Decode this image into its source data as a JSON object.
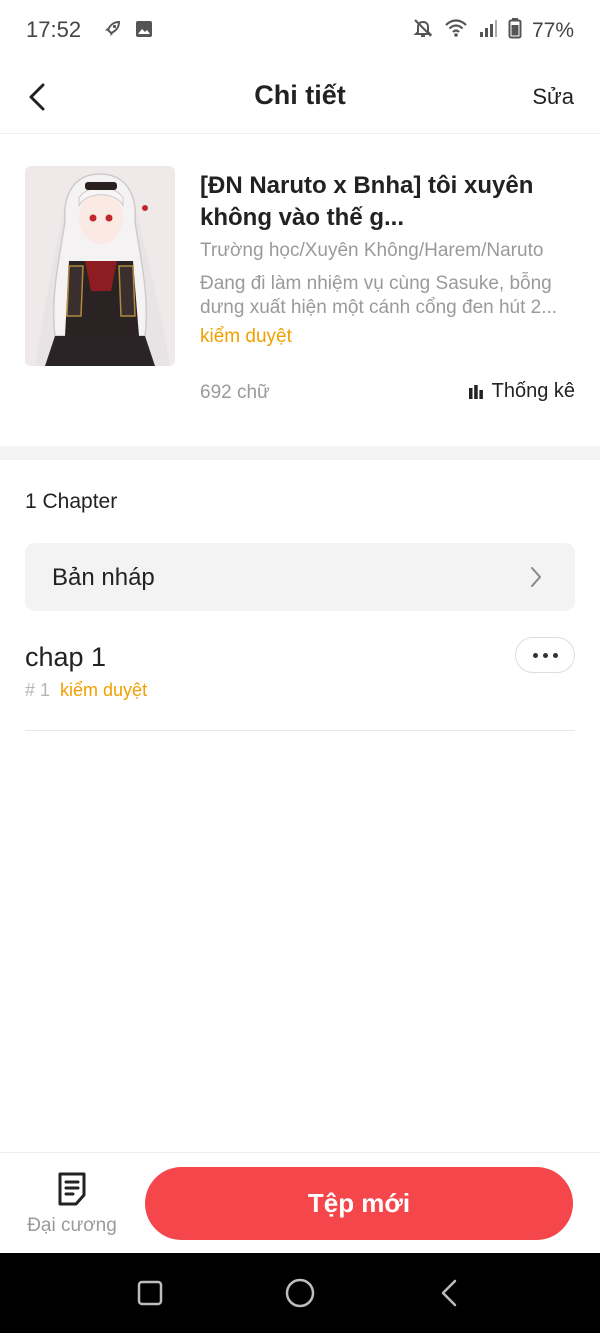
{
  "status_bar": {
    "time": "17:52",
    "battery": "77%",
    "left_icons": [
      "rocket-icon",
      "image-icon"
    ],
    "right_icons": [
      "bell-off-icon",
      "wifi-icon",
      "signal-icon",
      "battery-icon"
    ]
  },
  "header": {
    "title": "Chi tiết",
    "edit_label": "Sửa"
  },
  "book": {
    "title": "[ĐN Naruto x Bnha] tôi xuyên không vào thế g...",
    "tags": "Trường học/Xuyên Không/Harem/Naruto",
    "description": "Đang đi làm nhiệm vụ cùng Sasuke, bỗng dưng xuất hiện một cánh cổng đen hút 2...",
    "status": "kiểm duyệt",
    "word_count": "692 chữ",
    "stats_label": "Thống kê"
  },
  "chapters": {
    "count_label": "1 Chapter",
    "draft_label": "Bản nháp",
    "items": [
      {
        "title": "chap 1",
        "number": "# 1",
        "status": "kiểm duyệt"
      }
    ]
  },
  "bottom_bar": {
    "outline_label": "Đại cương",
    "new_file_label": "Tệp mới"
  },
  "colors": {
    "accent": "#f5474b",
    "status_orange": "#f0a000",
    "muted_text": "#9a9a9a"
  }
}
